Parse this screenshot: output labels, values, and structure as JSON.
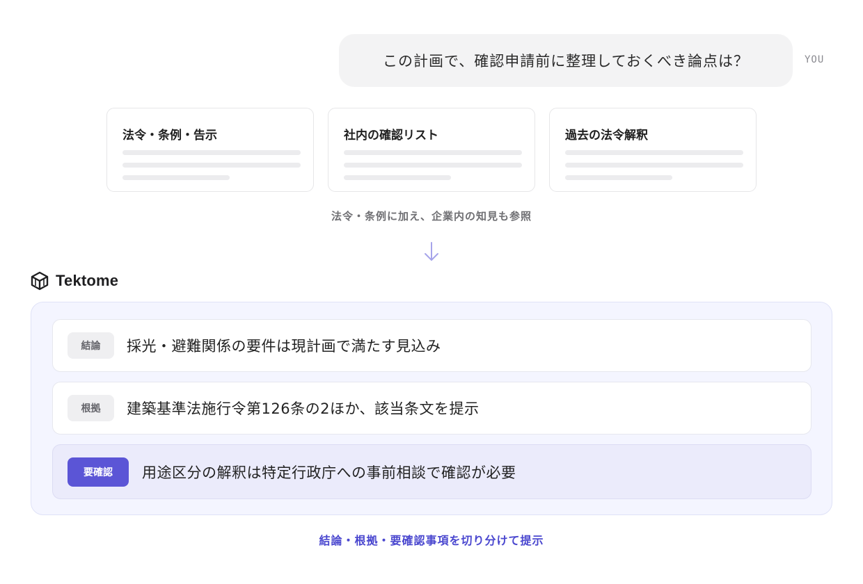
{
  "chat": {
    "user_message": "この計画で、確認申請前に整理しておくべき論点は？",
    "user_label": "YOU"
  },
  "sources": [
    {
      "title": "法令・条例・告示"
    },
    {
      "title": "社内の確認リスト"
    },
    {
      "title": "過去の法令解釈"
    }
  ],
  "sources_caption": "法令・条例に加え、企業内の知見も参照",
  "brand": {
    "name": "Tektome",
    "icon": "tektome-logo-icon"
  },
  "answer": {
    "rows": [
      {
        "tag": "結論",
        "text": "採光・避難関係の要件は現計画で満たす見込み"
      },
      {
        "tag": "根拠",
        "text": "建築基準法施行令第126条の2ほか、該当条文を提示"
      },
      {
        "tag": "要確認",
        "text": "用途区分の解釈は特定行政庁への事前相談で確認が必要"
      }
    ]
  },
  "bottom_caption": "結論・根拠・要確認事項を切り分けて提示",
  "colors": {
    "accent": "#5b55d6",
    "accent_text": "#4a47cf",
    "panel_bg": "#f4f5ff",
    "highlight_row_bg": "#ebebfb",
    "bubble_bg": "#f3f3f4"
  }
}
